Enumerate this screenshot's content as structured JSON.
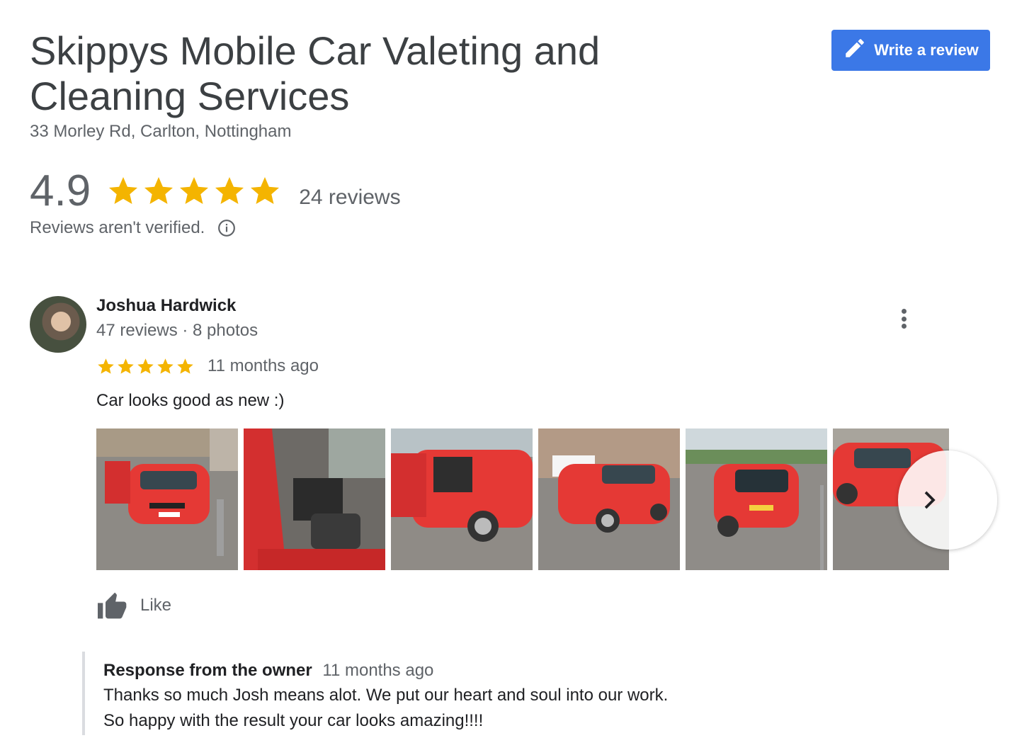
{
  "business": {
    "name": "Skippys Mobile Car Valeting and Cleaning Services",
    "address": "33 Morley Rd, Carlton, Nottingham"
  },
  "actions": {
    "write_review_label": "Write a review"
  },
  "rating": {
    "value": "4.9",
    "stars": 5,
    "count_label": "24 reviews",
    "unverified_note": "Reviews aren't verified."
  },
  "review": {
    "reviewer_name": "Joshua Hardwick",
    "reviewer_meta": "47 reviews · 8 photos",
    "stars": 5,
    "time_ago": "11 months ago",
    "text": "Car looks good as new :)",
    "photo_count_visible": 6,
    "like_label": "Like"
  },
  "owner_response": {
    "label": "Response from the owner",
    "time_ago": "11 months ago",
    "line1": "Thanks so much Josh means alot. We put our heart and soul into our work.",
    "line2": "So happy with the result your car looks amazing!!!!"
  },
  "colors": {
    "accent_blue": "#3b78e7",
    "star_gold": "#f4b400",
    "muted_text": "#5f6368",
    "car_red": "#e53935"
  },
  "icons": [
    "edit-pencil-icon",
    "star-icon",
    "info-icon",
    "more-vert-icon",
    "chevron-right-icon",
    "thumb-up-icon"
  ]
}
